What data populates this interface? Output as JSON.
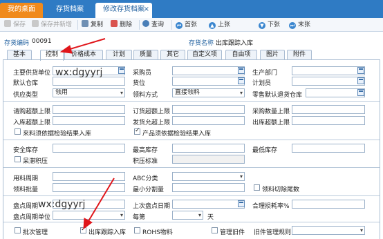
{
  "tabs": [
    "我的桌面",
    "存货档案",
    "修改存货档案"
  ],
  "toolbar": {
    "save": "保存",
    "save_new": "保存并新增",
    "copy": "复制",
    "delete": "删除",
    "query": "查询",
    "first": "首张",
    "prev": "上张",
    "next": "下张",
    "last": "末张"
  },
  "header": {
    "code_label": "存货编码",
    "code_value": "00091",
    "name_label": "存货名称",
    "name_value": "出库跟踪入库"
  },
  "subtabs": [
    "基本",
    "控制",
    "价格成本",
    "计划",
    "质量",
    "其它",
    "自定义项",
    "自由项",
    "图片",
    "附件"
  ],
  "form": {
    "main_supplier": "主要供货单位",
    "purchaser": "采购员",
    "production_dept": "生产部门",
    "default_warehouse": "默认仓库",
    "location": "货位",
    "planner": "计划员",
    "supply_type": "供应类型",
    "supply_type_value": "领用",
    "picking_method": "领料方式",
    "picking_method_value": "直接领料",
    "zero_out_return": "零售默认退货仓库",
    "req_over_limit": "请购超额上限",
    "order_over_limit": "订货超额上限",
    "purchase_qty_limit": "采购数量上限",
    "in_over_limit": "入库超额上限",
    "ship_allow_limit": "发货允超上限",
    "out_over_limit": "出库超额上限",
    "unqualified_chk": "来料须依据检验结果入库",
    "product_chk": "产品须依据检验结果入库",
    "safety_stock": "安全库存",
    "max_stock": "最高库存",
    "min_stock": "最低库存",
    "stock_excess": "呆滞积压",
    "excess_standard": "积压标准",
    "usage_cycle": "用料周期",
    "abc": "ABC分类",
    "picking_batch": "领料批量",
    "min_split": "最小分割量",
    "pick_cut_tail": "领料切除尾数",
    "check_cycle": "盘点周期",
    "last_check_date": "上次盘点日期",
    "reasonable_loss": "合理损耗率%",
    "check_cycle_unit": "盘点周期单位",
    "every_week": "每第",
    "day": "天",
    "batch_mgmt": "批次管理",
    "out_track_in": "出库跟踪入库",
    "rohs": "ROHS物料",
    "manage_old": "管理旧件",
    "old_rule": "旧件管理规则"
  },
  "watermark": "wx:dgyyrj",
  "colors": {
    "accent": "#2f7bc4",
    "active_tab": "#f08a1c",
    "annotation": "#e0161b"
  }
}
